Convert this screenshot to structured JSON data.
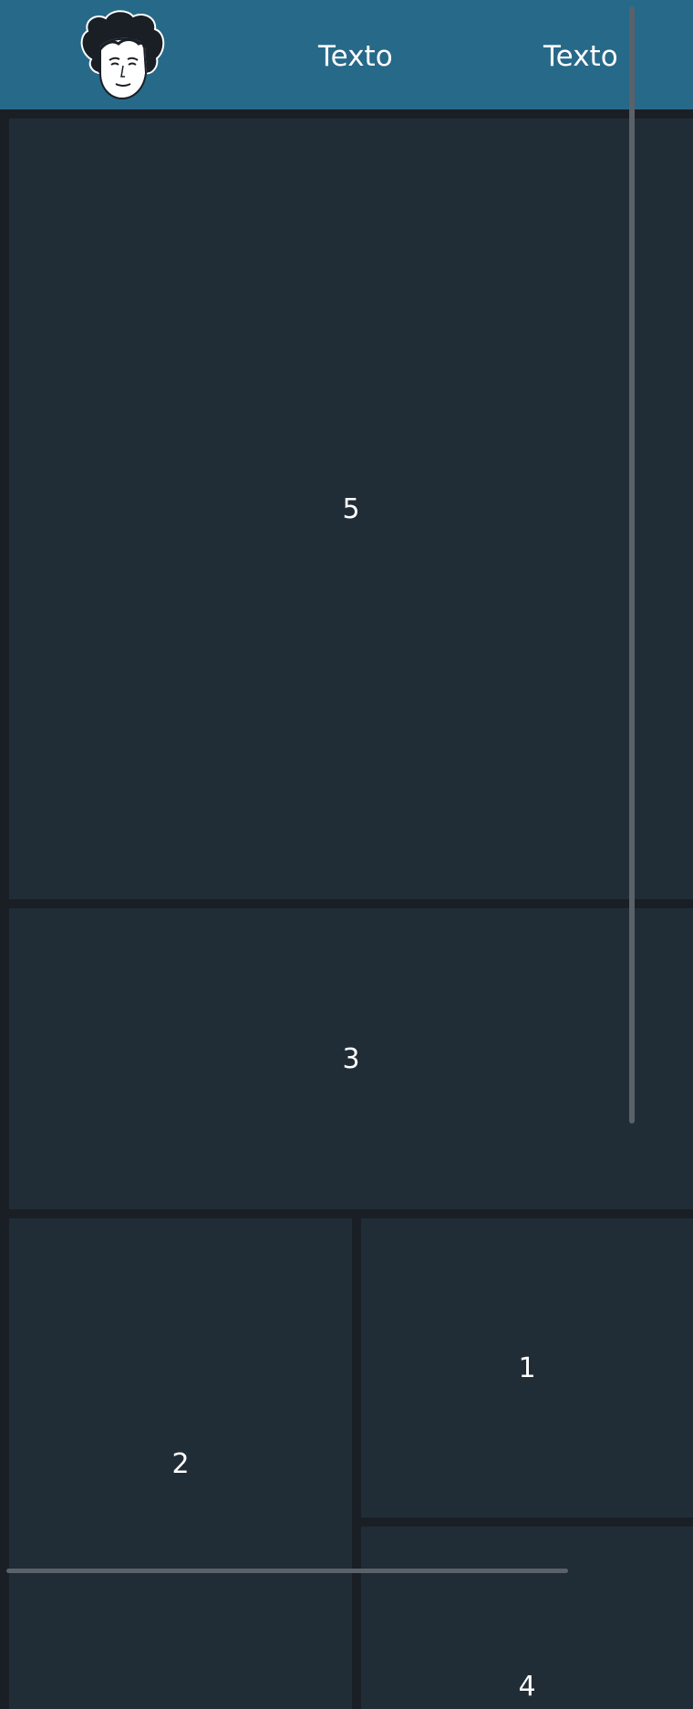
{
  "header": {
    "logo": {
      "icon": "avatar-face-icon"
    },
    "nav": [
      {
        "label": "Texto"
      },
      {
        "label": "Texto"
      }
    ]
  },
  "panels": [
    {
      "label": "5"
    },
    {
      "label": "3"
    },
    {
      "label": "2"
    },
    {
      "label": "1"
    },
    {
      "label": "4"
    }
  ],
  "colors": {
    "header_bg": "#276989",
    "page_bg": "#1a1f26",
    "panel_bg": "#212d36",
    "scrollbar": "#5a6169"
  }
}
